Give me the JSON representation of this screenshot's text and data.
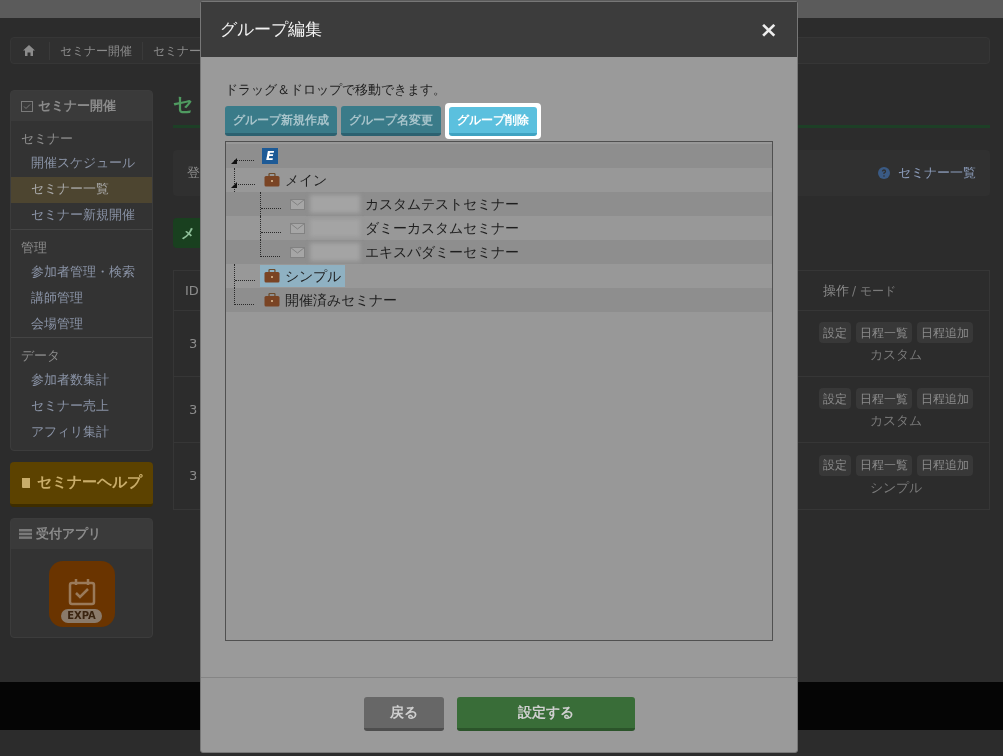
{
  "page": {
    "breadcrumb": [
      "セミナー開催",
      "セミナー"
    ],
    "sidebar": {
      "title": "セミナー開催",
      "sections": [
        {
          "heading": "セミナー",
          "items": [
            {
              "label": "開催スケジュール",
              "selected": false
            },
            {
              "label": "セミナー一覧",
              "selected": true
            },
            {
              "label": "セミナー新規開催",
              "selected": false
            }
          ]
        },
        {
          "heading": "管理",
          "items": [
            {
              "label": "参加者管理・検索",
              "selected": false
            },
            {
              "label": "講師管理",
              "selected": false
            },
            {
              "label": "会場管理",
              "selected": false
            }
          ]
        },
        {
          "heading": "データ",
          "items": [
            {
              "label": "参加者数集計",
              "selected": false
            },
            {
              "label": "セミナー売上",
              "selected": false
            },
            {
              "label": "アフィリ集計",
              "selected": false
            }
          ]
        }
      ]
    },
    "help_button": "セミナーヘルプ",
    "app_panel": {
      "title": "受付アプリ",
      "app_label": "EXPA"
    },
    "main": {
      "title": "セ",
      "info_label": "登",
      "help_link": "セミナー一覧",
      "green_button": "メ",
      "table": {
        "columns": [
          "ID",
          "操作"
        ],
        "column_note": "/ モード",
        "rows": [
          {
            "id": "3",
            "actions": [
              "設定",
              "日程一覧",
              "日程追加"
            ],
            "mode": "カスタム"
          },
          {
            "id": "3",
            "actions": [
              "設定",
              "日程一覧",
              "日程追加"
            ],
            "mode": "カスタム"
          },
          {
            "id": "3",
            "actions": [
              "設定",
              "日程一覧",
              "日程追加"
            ],
            "mode": "シンプル"
          }
        ]
      }
    }
  },
  "modal": {
    "title": "グループ編集",
    "close": "×",
    "hint": "ドラッグ＆ドロップで移動できます。",
    "toolbar": [
      {
        "label": "グループ新規作成",
        "highlighted": false
      },
      {
        "label": "グループ名変更",
        "highlighted": false
      },
      {
        "label": "グループ削除",
        "highlighted": true
      }
    ],
    "tree": [
      {
        "kind": "root",
        "icon_letter": "E",
        "expanded": true,
        "selected": false,
        "children": [
          {
            "kind": "folder",
            "label": "メイン",
            "expanded": true,
            "selected": false,
            "children": [
              {
                "kind": "item",
                "label": "カスタムテストセミナー",
                "selected": false
              },
              {
                "kind": "item",
                "label": "ダミーカスタムセミナー",
                "selected": false
              },
              {
                "kind": "item",
                "label": "エキスパダミーセミナー",
                "selected": false
              }
            ]
          },
          {
            "kind": "folder",
            "label": "シンプル",
            "selected": true
          },
          {
            "kind": "folder",
            "label": "開催済みセミナー",
            "selected": false
          }
        ]
      }
    ],
    "footer_buttons": [
      {
        "label": "戻る",
        "kind": "back"
      },
      {
        "label": "設定する",
        "kind": "primary"
      }
    ]
  }
}
